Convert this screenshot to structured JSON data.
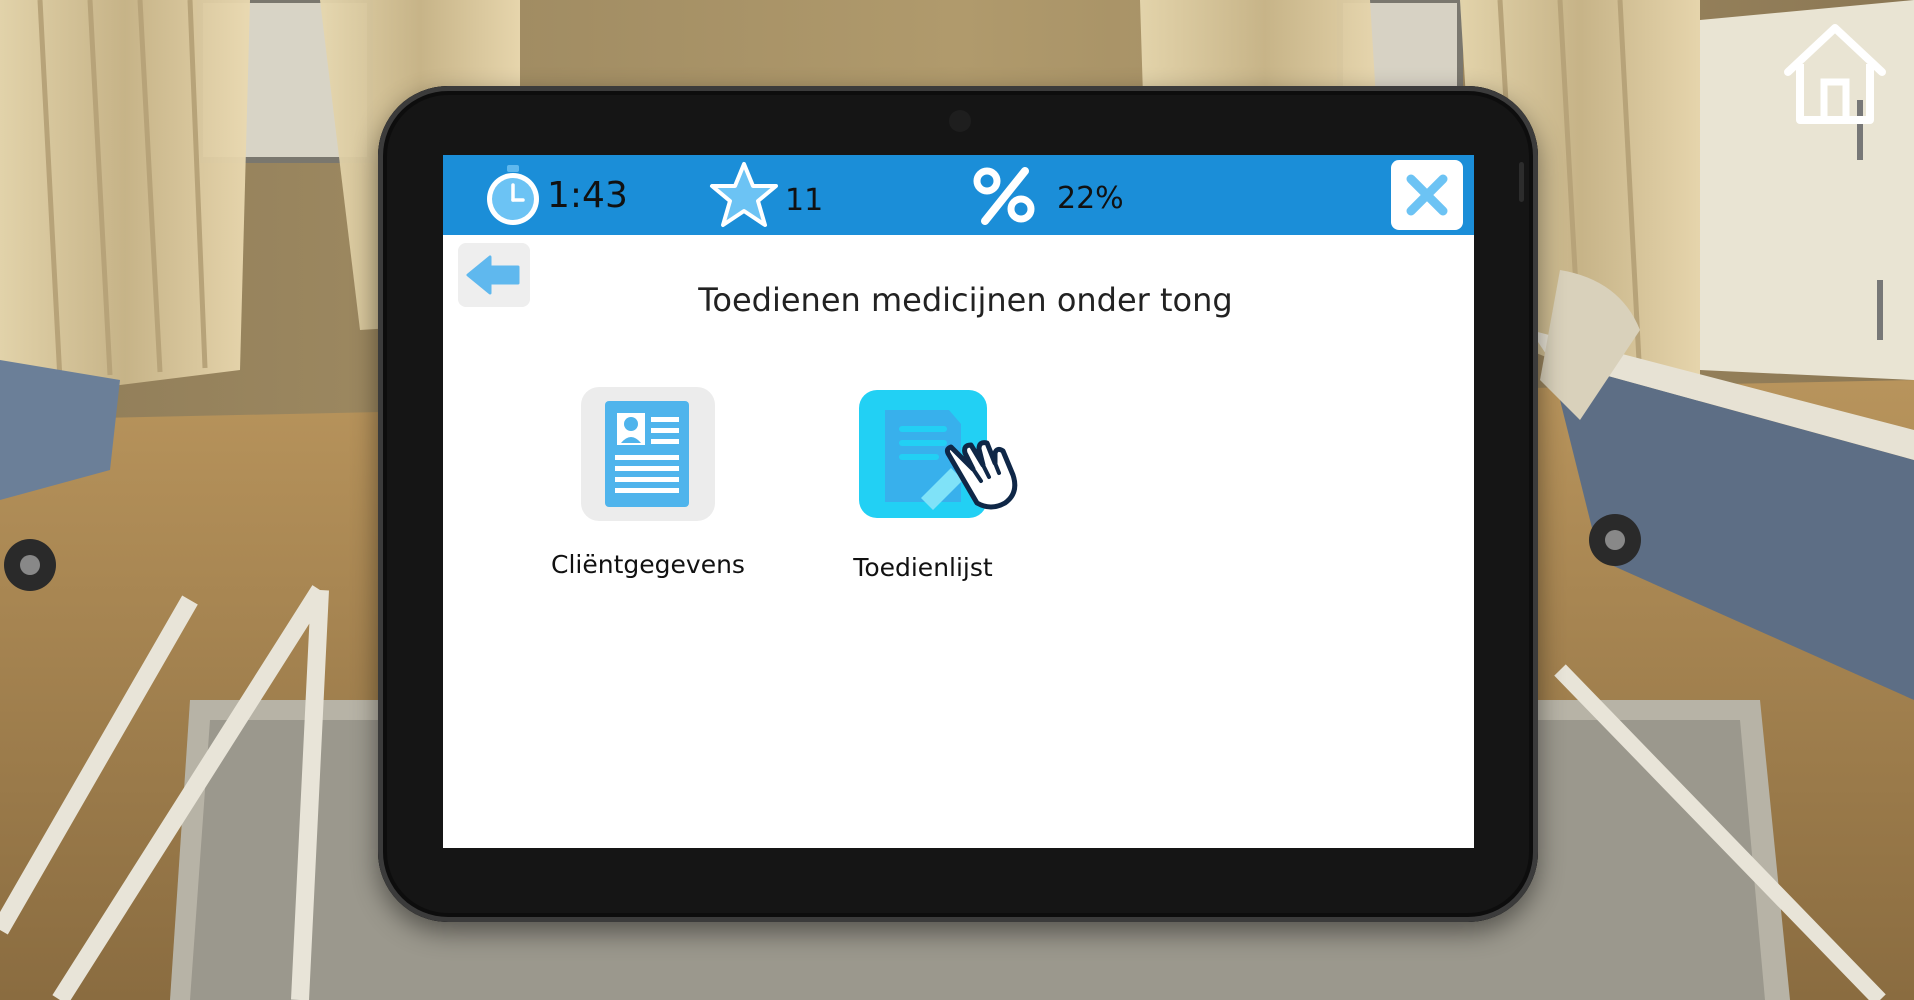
{
  "hud": {
    "timer": "1:43",
    "stars": "11",
    "percent": "22%",
    "accent_color": "#1b8ed8",
    "icons": [
      "stopwatch-icon",
      "star-icon",
      "percent-icon",
      "close-icon"
    ]
  },
  "page": {
    "title": "Toedienen medicijnen onder tong",
    "back_icon": "arrow-left-icon"
  },
  "apps": [
    {
      "label": "Cliëntgegevens",
      "icon": "client-record-icon"
    },
    {
      "label": "Toedienlijst",
      "icon": "medication-list-icon"
    }
  ],
  "scene": {
    "home_icon": "home-icon",
    "pointer_icon": "hand-pointer-icon"
  }
}
